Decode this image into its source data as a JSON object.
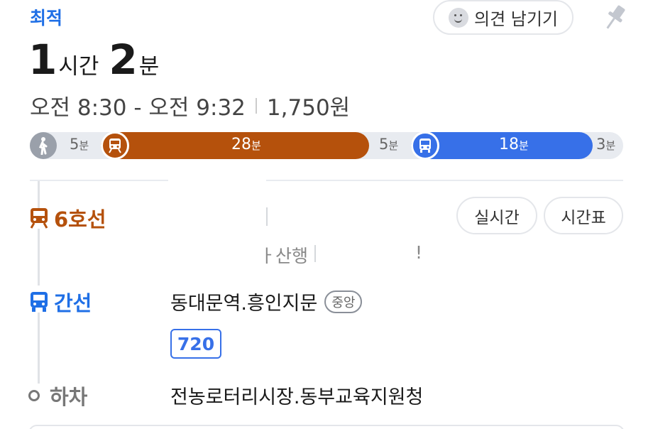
{
  "route": {
    "tag": "최적",
    "feedback_label": "의견 남기기"
  },
  "duration": {
    "hours": "1",
    "hours_unit": "시간",
    "minutes": "2",
    "minutes_unit": "분"
  },
  "times": {
    "range": "오전 8:30 - 오전 9:32",
    "fare": "1,750원"
  },
  "timeline": {
    "walk1": {
      "num": "5",
      "unit": "분"
    },
    "subway": {
      "num": "28",
      "unit": "분"
    },
    "walk2": {
      "num": "5",
      "unit": "분"
    },
    "bus": {
      "num": "18",
      "unit": "분"
    },
    "walk3": {
      "num": "3",
      "unit": "분"
    }
  },
  "subway_step": {
    "line": "6호선",
    "realtime_label": "실시간",
    "timetable_label": "시간표",
    "direction_fragment": "ㅏ산행",
    "fragment_mark": "!"
  },
  "bus_step": {
    "label": "간선",
    "stop": "동대문역.흥인지문",
    "stop_tag": "중앙",
    "bus_number": "720"
  },
  "alight_step": {
    "label": "하차",
    "stop": "전농로터리시장.동부교육지원청"
  },
  "colors": {
    "accent_blue": "#1f6fe6",
    "subway_brown": "#b5510c",
    "bus_blue": "#3770e8"
  }
}
